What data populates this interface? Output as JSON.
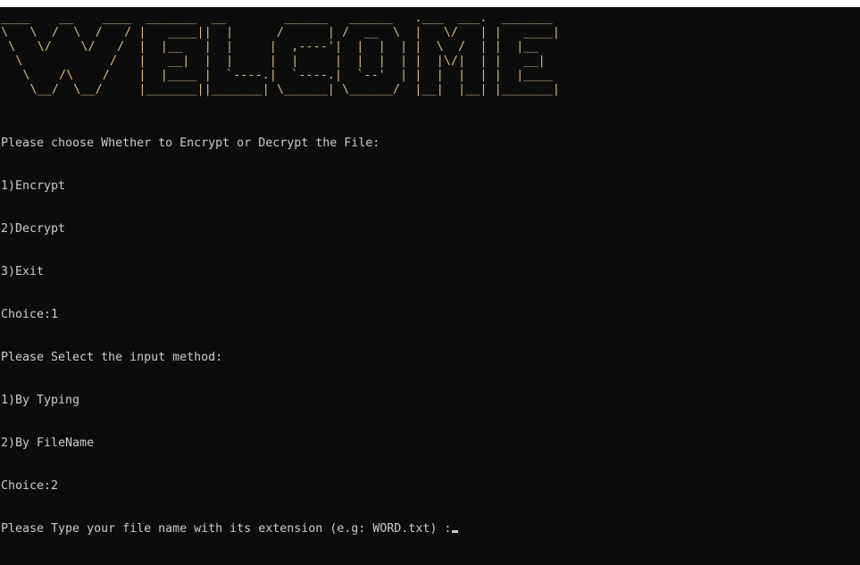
{
  "banner": {
    "lines": [
      "____    __    ____  _______  __        ______   ______   .___  ___.  _______ ",
      "\\   \\  /  \\  /   / |   ____||  |      /      | /  __  \\  |   \\/   | |   ____|",
      " \\   \\/    \\/   /  |  |__   |  |     |  ,----'|  |  |  | |  \\  /  | |  |__   ",
      "  \\            /   |   __|  |  |     |  |     |  |  |  | |  |\\/|  | |   __|  ",
      "   \\    /\\    /    |  |____ |  `----.|  `----.|  `--'  | |  |  |  | |  |____ ",
      "    \\__/  \\__/     |_______||_______| \\______| \\______/  |__|  |__| |_______|"
    ],
    "color": "#d9b98e"
  },
  "output": {
    "lines": [
      "Please choose Whether to Encrypt or Decrypt the File:",
      "1)Encrypt",
      "2)Decrypt",
      "3)Exit",
      "Choice:1",
      "Please Select the input method:",
      "1)By Typing",
      "2)By FileName",
      "Choice:2",
      "Please Type your file name with its extension (e.g: WORD.txt) :"
    ],
    "color": "#cccccc"
  },
  "colors": {
    "background": "#0c0c0c",
    "text": "#cccccc",
    "titlebar": "#ffffff"
  }
}
